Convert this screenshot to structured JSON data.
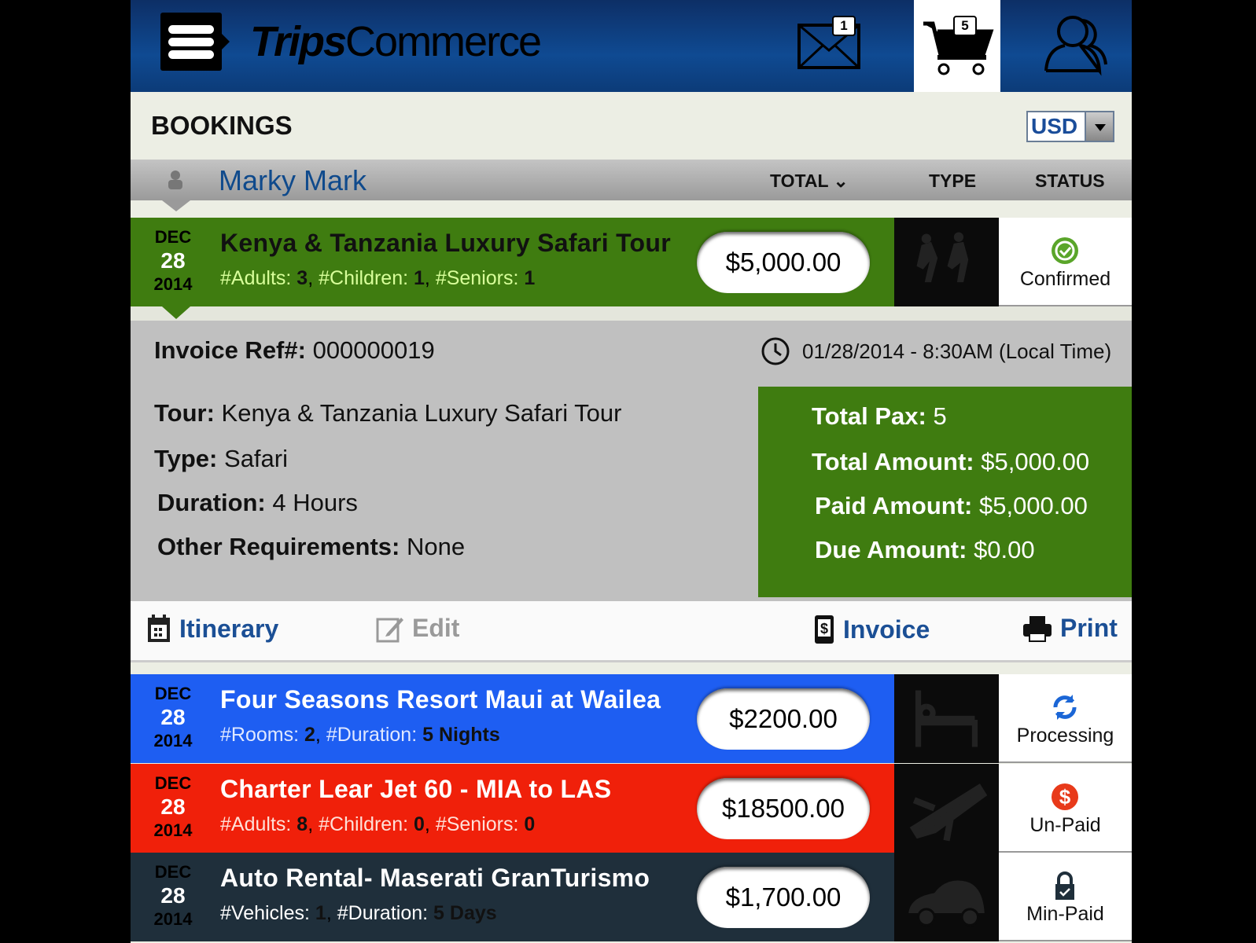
{
  "header": {
    "logo_part1": "Trips",
    "logo_part2": "Commerce",
    "mail_count": "1",
    "cart_count": "5"
  },
  "bookings": {
    "title": "BOOKINGS",
    "currency": "USD"
  },
  "user_bar": {
    "name": "Marky Mark",
    "col_total": "TOTAL",
    "col_type": "TYPE",
    "col_status": "STATUS"
  },
  "colors": {
    "header": "#0f4a92",
    "confirmed_row": "#3f7c10",
    "processing_row": "#1e5ef2",
    "unpaid_row": "#f0200a",
    "minpaid_row": "#1f2f3b"
  },
  "rows": [
    {
      "month": "DEC",
      "day": "28",
      "year": "2014",
      "title": "Kenya & Tanzania Luxury Safari Tour",
      "details": [
        [
          "#Adults:",
          "3"
        ],
        [
          "#Children:",
          "1"
        ],
        [
          "#Seniors:",
          "1"
        ]
      ],
      "price": "$5,000.00",
      "type_icon": "hiking-icon",
      "status": "Confirmed",
      "status_icon": "check-badge-icon"
    },
    {
      "month": "DEC",
      "day": "28",
      "year": "2014",
      "title": "Four Seasons Resort Maui at Wailea",
      "details": [
        [
          "#Rooms:",
          "2"
        ],
        [
          "#Duration:",
          "5 Nights"
        ]
      ],
      "price": "$2200.00",
      "type_icon": "bed-icon",
      "status": "Processing",
      "status_icon": "refresh-icon"
    },
    {
      "month": "DEC",
      "day": "28",
      "year": "2014",
      "title": "Charter Lear Jet 60 - MIA to LAS",
      "details": [
        [
          "#Adults:",
          "8"
        ],
        [
          "#Children:",
          "0"
        ],
        [
          "#Seniors:",
          "0"
        ]
      ],
      "price": "$18500.00",
      "type_icon": "plane-icon",
      "status": "Un-Paid",
      "status_icon": "dollar-icon"
    },
    {
      "month": "DEC",
      "day": "28",
      "year": "2014",
      "title": "Auto Rental- Maserati GranTurismo",
      "details": [
        [
          "#Vehicles:",
          "1"
        ],
        [
          "#Duration:",
          "5 Days"
        ]
      ],
      "price": "$1,700.00",
      "type_icon": "car-icon",
      "status": "Min-Paid",
      "status_icon": "lock-check-icon"
    }
  ],
  "detail": {
    "invoice_label": "Invoice Ref#:",
    "invoice_value": "000000019",
    "datetime": "01/28/2014 - 8:30AM (Local Time)",
    "tour_label": "Tour:",
    "tour_value": "Kenya & Tanzania Luxury Safari  Tour",
    "type_label": "Type:",
    "type_value": "Safari",
    "duration_label": "Duration:",
    "duration_value": "4 Hours",
    "other_label": "Other Requirements:",
    "other_value": "None",
    "pax_label": "Total Pax:",
    "pax_value": "5",
    "total_label": "Total Amount:",
    "total_value": "$5,000.00",
    "paid_label": "Paid Amount:",
    "paid_value": "$5,000.00",
    "due_label": "Due Amount:",
    "due_value": "$0.00"
  },
  "actions": {
    "itinerary": "Itinerary",
    "edit": "Edit",
    "invoice": "Invoice",
    "print": "Print"
  }
}
